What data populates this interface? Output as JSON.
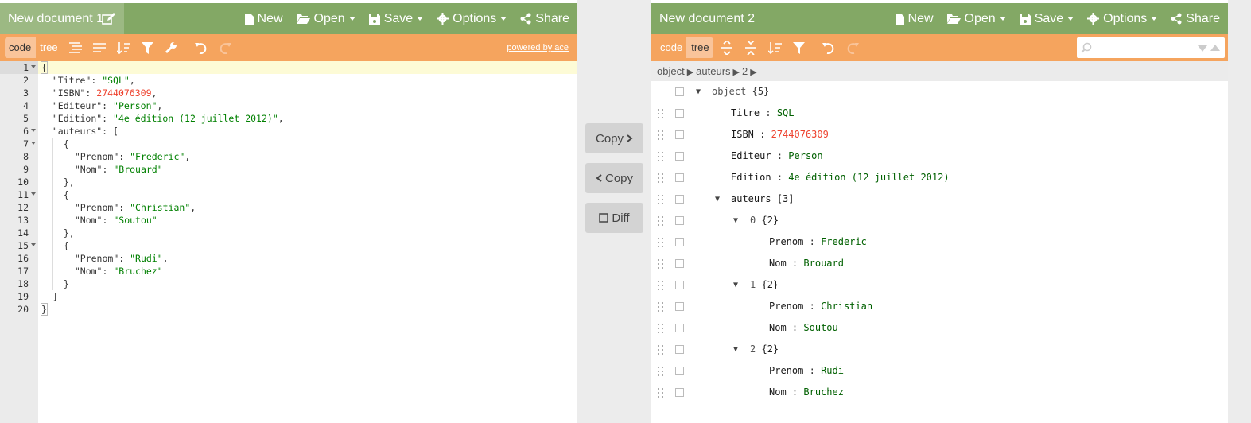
{
  "left": {
    "title": "New document 1",
    "menu": [
      "New",
      "Open",
      "Save",
      "Options",
      "Share"
    ],
    "modes": [
      "code",
      "tree"
    ],
    "powered_by": "powered by ace",
    "lines": [
      {
        "num": "1",
        "fold": true
      },
      {
        "num": "2"
      },
      {
        "num": "3"
      },
      {
        "num": "4"
      },
      {
        "num": "5"
      },
      {
        "num": "6",
        "fold": true
      },
      {
        "num": "7",
        "fold": true
      },
      {
        "num": "8"
      },
      {
        "num": "9"
      },
      {
        "num": "10"
      },
      {
        "num": "11",
        "fold": true
      },
      {
        "num": "12"
      },
      {
        "num": "13"
      },
      {
        "num": "14"
      },
      {
        "num": "15",
        "fold": true
      },
      {
        "num": "16"
      },
      {
        "num": "17"
      },
      {
        "num": "18"
      },
      {
        "num": "19"
      },
      {
        "num": "20"
      }
    ],
    "code": {
      "l1": "{",
      "titre_key": "\"Titre\"",
      "titre_val": "\"SQL\"",
      "isbn_key": "\"ISBN\"",
      "isbn_val": "2744076309",
      "editeur_key": "\"Editeur\"",
      "editeur_val": "\"Person\"",
      "edition_key": "\"Edition\"",
      "edition_val": "\"4e édition (12 juillet 2012)\"",
      "auteurs_key": "\"auteurs\"",
      "prenom_key": "\"Prenom\"",
      "nom_key": "\"Nom\"",
      "a1_prenom": "\"Frederic\"",
      "a1_nom": "\"Brouard\"",
      "a2_prenom": "\"Christian\"",
      "a2_nom": "\"Soutou\"",
      "a3_prenom": "\"Rudi\"",
      "a3_nom": "\"Bruchez\"",
      "l20": "}"
    }
  },
  "middle": {
    "copy_right": "Copy",
    "copy_left": "Copy",
    "diff": "Diff"
  },
  "right": {
    "title": "New document 2",
    "menu": [
      "New",
      "Open",
      "Save",
      "Options",
      "Share"
    ],
    "modes": [
      "code",
      "tree"
    ],
    "breadcrumb": [
      "object",
      "auteurs",
      "2"
    ],
    "tree": {
      "root": "object",
      "root_count": "{5}",
      "titre_k": "Titre",
      "titre_v": "SQL",
      "isbn_k": "ISBN",
      "isbn_v": "2744076309",
      "editeur_k": "Editeur",
      "editeur_v": "Person",
      "edition_k": "Edition",
      "edition_v": "4e édition (12 juillet 2012)",
      "auteurs_k": "auteurs",
      "auteurs_count": "[3]",
      "idx0": "0",
      "idx1": "1",
      "idx2": "2",
      "obj_count": "{2}",
      "prenom_k": "Prenom",
      "nom_k": "Nom",
      "a1_prenom": "Frederic",
      "a1_nom": "Brouard",
      "a2_prenom": "Christian",
      "a2_nom": "Soutou",
      "a3_prenom": "Rudi",
      "a3_nom": "Bruchez",
      "colon": ":"
    }
  }
}
